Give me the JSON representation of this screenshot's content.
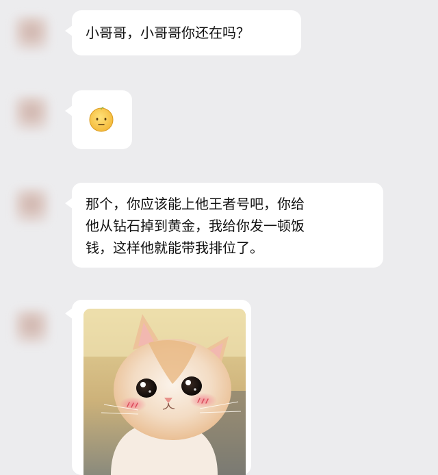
{
  "messages": [
    {
      "type": "text",
      "lines": [
        "小哥哥，小哥哥你还在吗？"
      ]
    },
    {
      "type": "emoji",
      "icon": "awkward-face-emoji"
    },
    {
      "type": "text",
      "lines": [
        "那个，你应该能上他王者号吧，你给",
        "他从钻石掉到黄金，我给你发一顿饭",
        "钱，这样他就能带我排位了。"
      ]
    },
    {
      "type": "image",
      "icon": "cute-cat-sticker"
    }
  ],
  "colors": {
    "background": "#ececee",
    "bubble": "#ffffff",
    "text": "#111111"
  }
}
